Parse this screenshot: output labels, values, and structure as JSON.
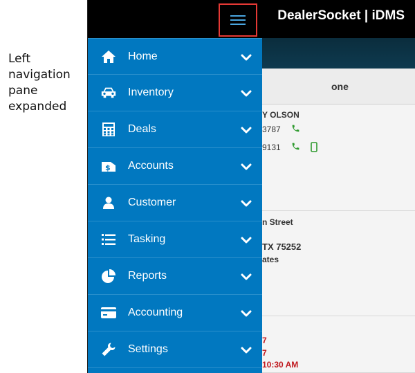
{
  "caption": {
    "lines": [
      "Left",
      "navigation",
      "pane",
      "expanded"
    ]
  },
  "header": {
    "brand": "DealerSocket | iDMS",
    "menu_icon": "hamburger-icon",
    "highlight_color": "#e53935"
  },
  "nav": {
    "background": "#0178c0",
    "items": [
      {
        "label": "Home",
        "icon": "home-icon"
      },
      {
        "label": "Inventory",
        "icon": "car-icon"
      },
      {
        "label": "Deals",
        "icon": "calculator-icon"
      },
      {
        "label": "Accounts",
        "icon": "money-icon"
      },
      {
        "label": "Customer",
        "icon": "user-icon"
      },
      {
        "label": "Tasking",
        "icon": "list-icon"
      },
      {
        "label": "Reports",
        "icon": "pie-chart-icon"
      },
      {
        "label": "Accounting",
        "icon": "credit-card-icon"
      },
      {
        "label": "Settings",
        "icon": "wrench-icon"
      }
    ]
  },
  "background": {
    "column_header": "one",
    "card1": {
      "name": "Y OLSON",
      "phone1": "3787",
      "phone2": "9131"
    },
    "card2": {
      "line1": "n Street",
      "line2": "TX 75252",
      "line3": "ates"
    },
    "card3": {
      "line1": "7",
      "line2": "7",
      "time": "10:30 AM"
    }
  }
}
